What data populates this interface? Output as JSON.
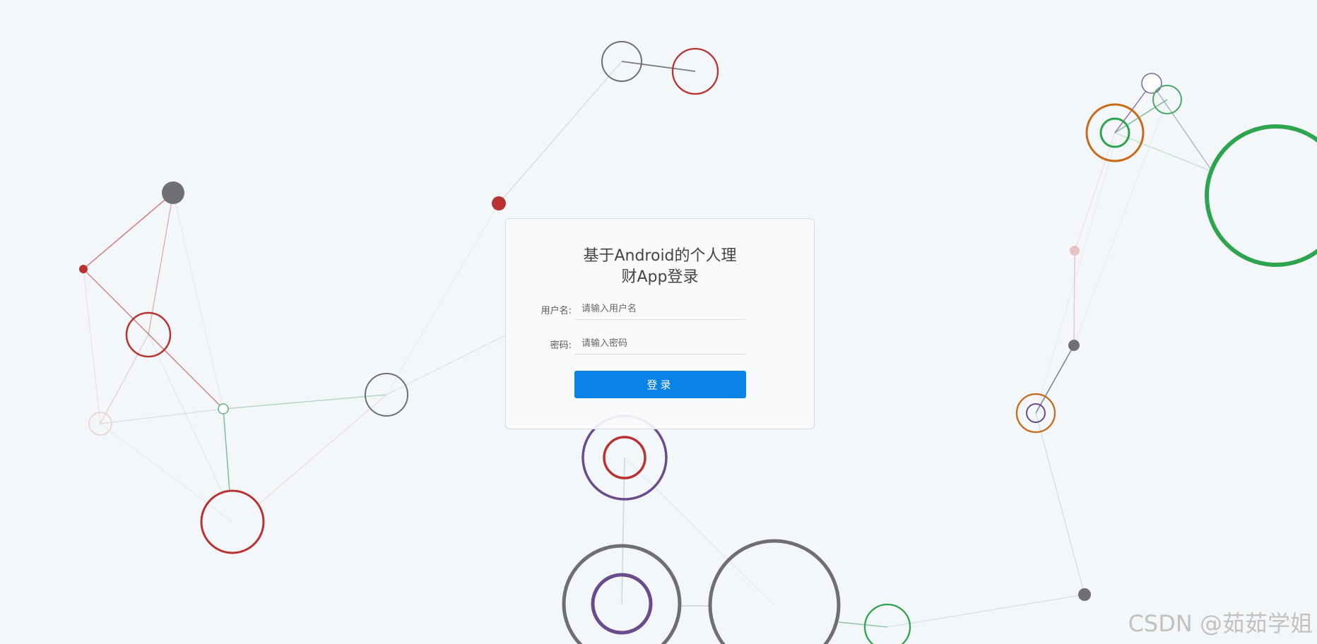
{
  "login": {
    "title_line1": "基于Android的个人理",
    "title_line2": "财App登录",
    "username_label": "用户名:",
    "username_placeholder": "请输入用户名",
    "password_label": "密码:",
    "password_placeholder": "请输入密码",
    "submit_label": "登录"
  },
  "watermark": "CSDN @茹茹学姐",
  "colors": {
    "button": "#0a83e6",
    "background": "#f4f7fa",
    "red": "#b83232",
    "gray": "#6f6f73",
    "green": "#2ea44f",
    "purple": "#6a4c8c",
    "orange": "#c86a1c",
    "pink": "#e8c2c2"
  }
}
